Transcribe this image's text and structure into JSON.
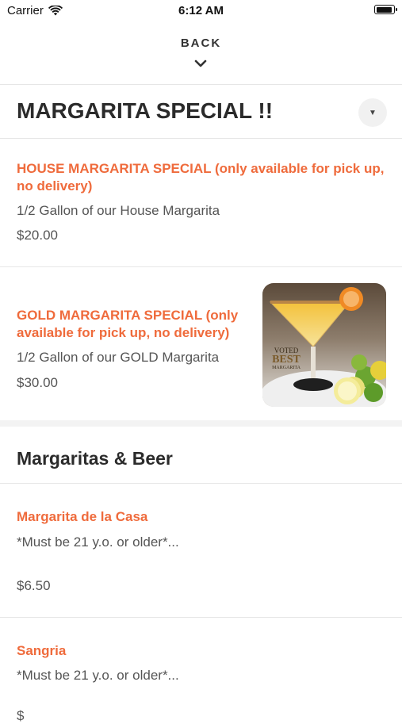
{
  "status": {
    "carrier": "Carrier",
    "time": "6:12 AM"
  },
  "nav": {
    "back_label": "BACK"
  },
  "category": {
    "title": "MARGARITA SPECIAL !!"
  },
  "items": [
    {
      "name_line1": "HOUSE MARGARITA SPECIAL (only available for pick up,",
      "name_line2": "no delivery)",
      "description": "1/2 Gallon of our House Margarita",
      "price": "$20.00"
    },
    {
      "name_line1": "GOLD MARGARITA SPECIAL (only",
      "name_line2": "available for pick up, no delivery)",
      "description": "1/2 Gallon of our GOLD Margarita",
      "price": "$30.00",
      "image_badge": {
        "line1": "VOTED",
        "line2": "BEST",
        "line3": "MARGARITA"
      }
    }
  ],
  "section": {
    "title": "Margaritas & Beer"
  },
  "section_items": [
    {
      "name": "Margarita de la Casa",
      "description": "*Must be 21 y.o. or older*...",
      "price": "$6.50"
    },
    {
      "name": "Sangria",
      "description": "*Must be 21 y.o. or older*...",
      "price": "$"
    }
  ],
  "colors": {
    "accent": "#ef6b3c",
    "text": "#555555",
    "title": "#2b2b2b"
  },
  "icons": {
    "wifi": "wifi-icon",
    "battery": "battery-icon",
    "chevron": "chevron-down-icon",
    "dropdown": "caret-down-icon"
  }
}
